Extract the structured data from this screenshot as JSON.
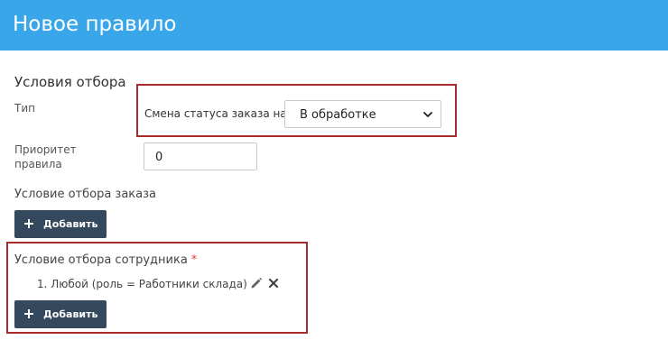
{
  "header": {
    "title": "Новое правило"
  },
  "form": {
    "section_title": "Условия отбора",
    "type_label": "Тип",
    "type_inline_label": "Смена статуса заказа на",
    "status_select": {
      "value": "В обработке"
    },
    "priority_label": "Приоритет правила",
    "priority_value": "0",
    "order_condition_label": "Условие отбора заказа",
    "add_order_button_label": "Добавить",
    "employee_condition_label": "Условие отбора сотрудника",
    "required_mark": "*",
    "employee_conditions": [
      {
        "text": "1. Любой (роль = Работники склада)"
      }
    ],
    "add_employee_button_label": "Добавить"
  },
  "icons": {
    "select_arrow": "chevron-down-icon",
    "add": "plus-icon",
    "edit": "pencil-icon",
    "remove": "close-icon"
  },
  "colors": {
    "header_bg": "#3aa6ea",
    "button_bg": "#34495e",
    "highlight_border": "#a82a2a",
    "required": "#e03b3b"
  }
}
